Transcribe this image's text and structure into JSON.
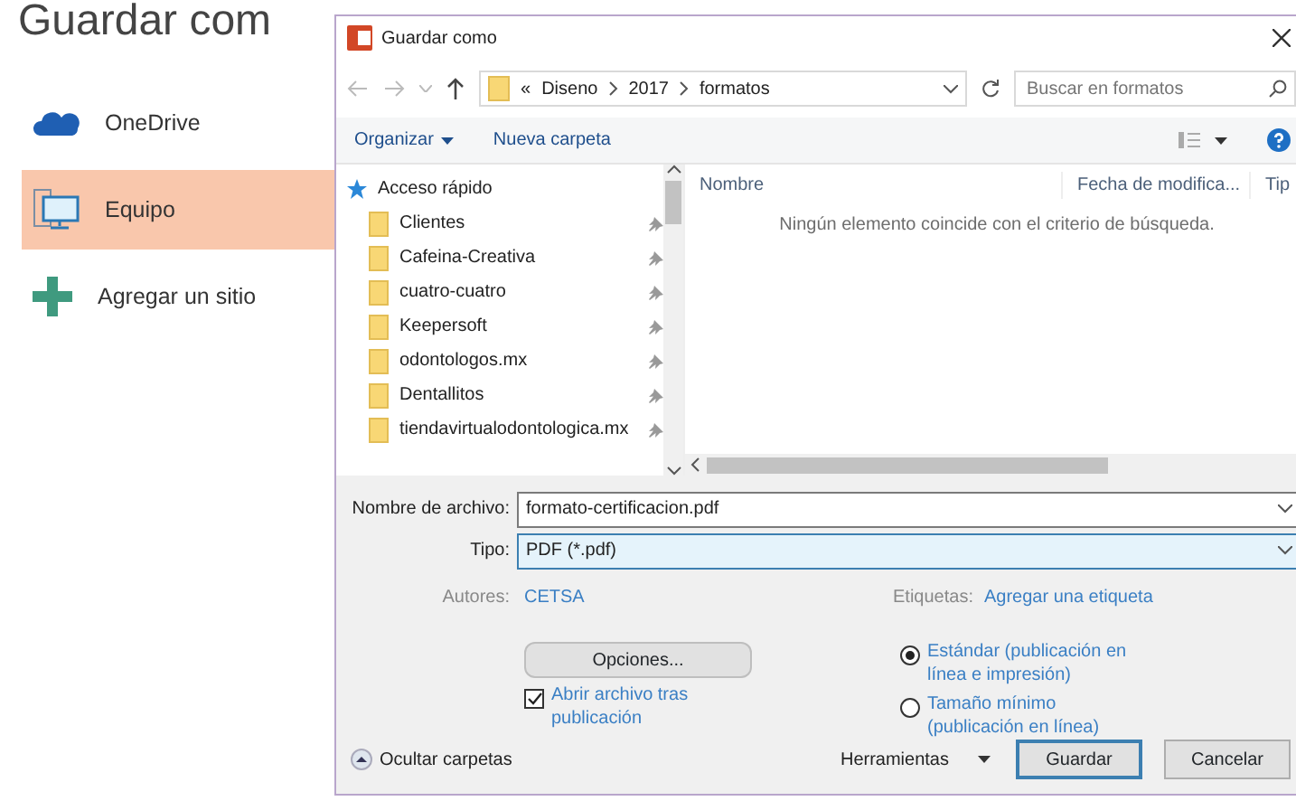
{
  "page_title": "Guardar com",
  "locations": [
    {
      "label": "OneDrive",
      "kind": "cloud",
      "selected": false
    },
    {
      "label": "Equipo",
      "kind": "computer",
      "selected": true
    },
    {
      "label": "Agregar un sitio",
      "kind": "add",
      "selected": false
    }
  ],
  "dialog": {
    "title": "Guardar como",
    "path": {
      "prefix": "«",
      "segments": [
        "Diseno",
        "2017",
        "formatos"
      ]
    },
    "search": {
      "placeholder": "Buscar en formatos"
    },
    "toolbar": {
      "organize": "Organizar",
      "new_folder": "Nueva carpeta"
    },
    "nav": {
      "header": "Acceso rápido",
      "items": [
        {
          "label": "Clientes",
          "pinned": true
        },
        {
          "label": "Cafeina-Creativa",
          "pinned": true
        },
        {
          "label": "cuatro-cuatro",
          "pinned": true
        },
        {
          "label": "Keepersoft",
          "pinned": true
        },
        {
          "label": "odontologos.mx",
          "pinned": true
        },
        {
          "label": "Dentallitos",
          "pinned": true
        },
        {
          "label": "tiendavirtualodontologica.mx",
          "pinned": true
        }
      ]
    },
    "columns": [
      "Nombre",
      "Fecha de modifica...",
      "Tip"
    ],
    "empty_message": "Ningún elemento coincide con el criterio de búsqueda.",
    "filename": {
      "label": "Nombre de archivo:",
      "value": "formato-certificacion.pdf"
    },
    "file_type": {
      "label": "Tipo:",
      "value": "PDF (*.pdf)"
    },
    "authors": {
      "label": "Autores:",
      "value": "CETSA"
    },
    "tags": {
      "label": "Etiquetas:",
      "value": "Agregar una etiqueta"
    },
    "options_button": "Opciones...",
    "open_after": {
      "label": "Abrir archivo tras publicación",
      "checked": true
    },
    "optimize": [
      {
        "label": "Estándar (publicación en línea e impresión)",
        "selected": true
      },
      {
        "label": "Tamaño mínimo (publicación en línea)",
        "selected": false
      }
    ],
    "hide_folders": "Ocultar carpetas",
    "tools": "Herramientas",
    "buttons": [
      {
        "label": "Guardar",
        "kind": "primary"
      },
      {
        "label": "Cancelar",
        "kind": "secondary"
      }
    ]
  }
}
